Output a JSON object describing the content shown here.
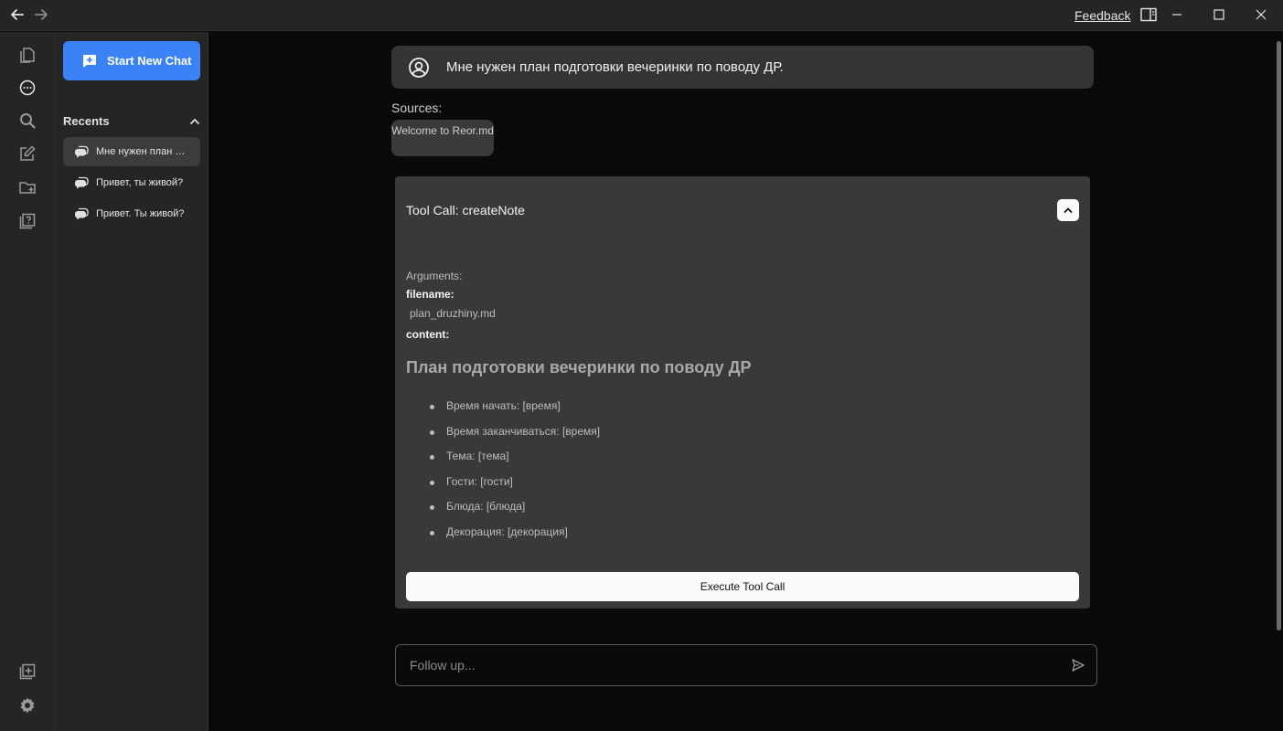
{
  "titlebar": {
    "feedback_label": "Feedback",
    "icons": [
      "back-arrow-icon",
      "forward-arrow-icon",
      "sidebar-toggle-icon",
      "minimize-icon",
      "maximize-icon",
      "close-icon"
    ]
  },
  "iconbar": {
    "top_icons": [
      "files-icon",
      "chat-icon",
      "search-icon",
      "edit-icon",
      "new-folder-icon",
      "help-icon"
    ],
    "bottom_icons": [
      "new-window-icon",
      "settings-icon"
    ]
  },
  "sidebar": {
    "new_chat_label": "Start New Chat",
    "recents_label": "Recents",
    "items": [
      {
        "label": "Мне нужен план подготовки вечеринки по поводу ДР.",
        "active": true
      },
      {
        "label": "Привет, ты живой?",
        "active": false
      },
      {
        "label": "Привет. Ты живой?",
        "active": false
      }
    ]
  },
  "chat": {
    "user_message": "Мне нужен план подготовки вечеринки по поводу ДР.",
    "sources_label": "Sources:",
    "sources": [
      "Welcome to Reor.md"
    ],
    "tool_call": {
      "title": "Tool Call: createNote",
      "arguments_label": "Arguments:",
      "filename_key": "filename:",
      "filename_value": "plan_druzhiny.md",
      "content_key": "content:",
      "note_heading": "План подготовки вечеринки по поводу ДР",
      "note_items": [
        "Время начать: [время]",
        "Время заканчиваться: [время]",
        "Тема: [тема]",
        "Гости: [гости]",
        "Блюда: [блюда]",
        "Декорация: [декорация]"
      ],
      "execute_label": "Execute Tool Call"
    },
    "followup_placeholder": "Follow up..."
  },
  "colors": {
    "accent": "#3b82f6",
    "background": "#0b0a09",
    "panel": "#252525",
    "card": "#393939"
  }
}
